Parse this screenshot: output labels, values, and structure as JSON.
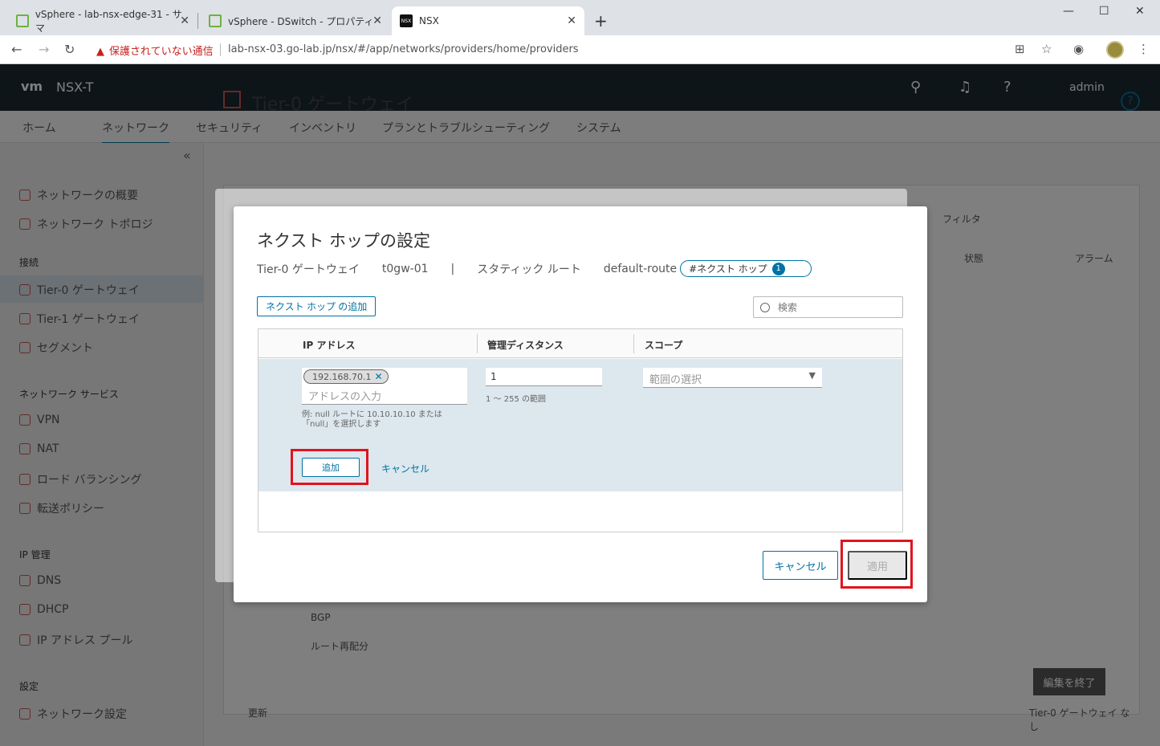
{
  "browser": {
    "tabs": [
      {
        "title": "vSphere - lab-nsx-edge-31 - サマ",
        "active": false
      },
      {
        "title": "vSphere - DSwitch - プロパティ",
        "active": false
      },
      {
        "title": "NSX",
        "active": true
      }
    ],
    "new_tab": "+",
    "security_warning": "保護されていない通信",
    "url": "lab-nsx-03.go-lab.jp/nsx/#/app/networks/providers/home/providers"
  },
  "header": {
    "logo": "vm",
    "product": "NSX-T",
    "user": "admin"
  },
  "mainnav": [
    "ホーム",
    "ネットワーク",
    "セキュリティ",
    "インベントリ",
    "プランとトラブルシューティング",
    "システム"
  ],
  "sidebar": {
    "items_top": [
      "ネットワークの概要",
      "ネットワーク トポロジ"
    ],
    "section_connection": "接続",
    "connection_items": [
      "Tier-0 ゲートウェイ",
      "Tier-1 ゲートウェイ",
      "セグメント"
    ],
    "section_services": "ネットワーク サービス",
    "service_items": [
      "VPN",
      "NAT",
      "ロード バランシング",
      "転送ポリシー"
    ],
    "section_ip": "IP 管理",
    "ip_items": [
      "DNS",
      "DHCP",
      "IP アドレス プール"
    ],
    "section_settings": "設定",
    "settings_items": [
      "ネットワーク設定"
    ]
  },
  "content": {
    "title": "Tier-0 ゲートウェイ",
    "filter_placeholder": "フィルタ",
    "col_status": "状態",
    "col_alarm": "アラーム",
    "bgp": "BGP",
    "route_redist": "ルート再配分",
    "done_editing": "編集を終了",
    "refresh": "更新",
    "footer_right": "Tier-0 ゲートウェイ なし"
  },
  "modal": {
    "title": "ネクスト ホップの設定",
    "crumb_type": "Tier-0 ゲートウェイ",
    "crumb_gw": "t0gw-01",
    "crumb_sep": "|",
    "crumb_route_type": "スタティック ルート",
    "crumb_route": "default-route",
    "pill_label": "#ネクスト ホップ",
    "pill_count": "1",
    "add_next_hop": "ネクスト ホップ の追加",
    "search_placeholder": "検索",
    "columns": [
      "IP アドレス",
      "管理ディスタンス",
      "スコープ"
    ],
    "row": {
      "ip_chip": "192.168.70.1",
      "ip_placeholder": "アドレスの入力",
      "ip_hint_1": "例: null ルートに 10.10.10.10 または",
      "ip_hint_2": "「null」を選択します",
      "distance": "1",
      "distance_hint": "1 ～ 255 の範囲",
      "scope_placeholder": "範囲の選択",
      "add_label": "追加",
      "cancel_label": "キャンセル"
    },
    "cancel_button": "キャンセル",
    "apply_button": "適用"
  }
}
